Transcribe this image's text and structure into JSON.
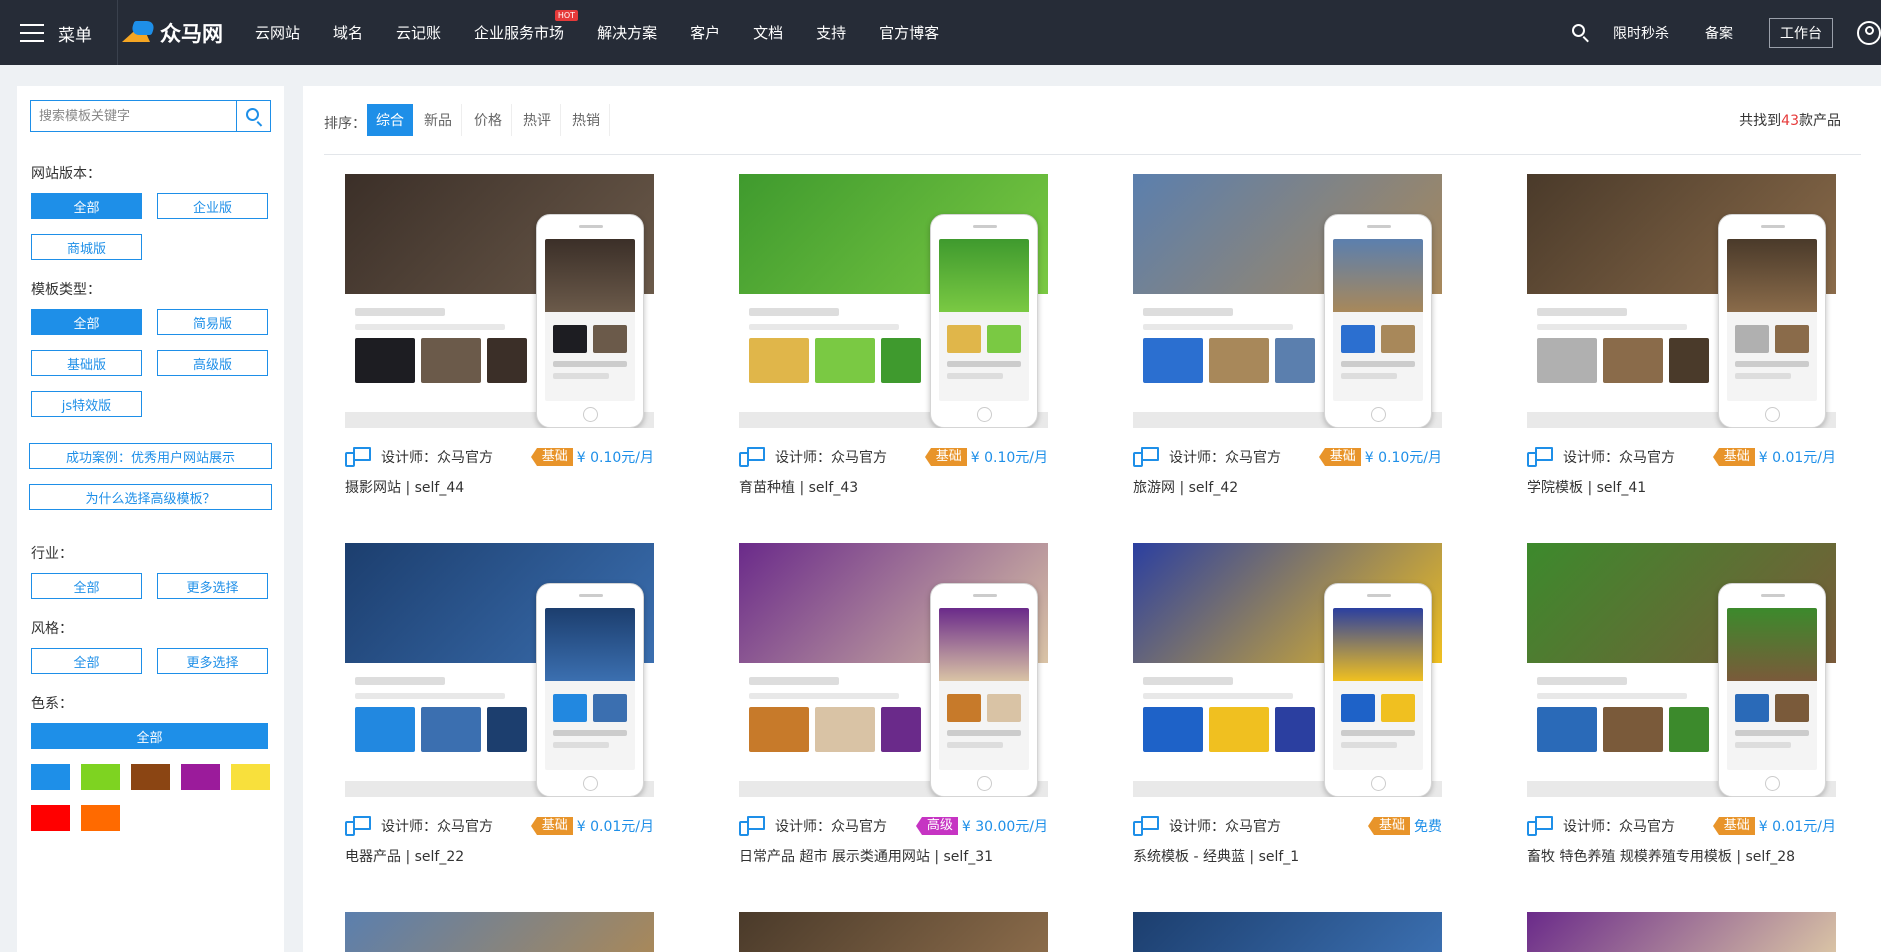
{
  "topbar": {
    "menu_label": "菜单",
    "logo_text": "众马网",
    "nav": [
      "云网站",
      "域名",
      "云记账",
      "企业服务市场",
      "解决方案",
      "客户",
      "文档",
      "支持",
      "官方博客"
    ],
    "hot_badge": "HOT",
    "right": {
      "flash_sale": "限时秒杀",
      "record": "备案",
      "workspace": "工作台"
    }
  },
  "sidebar": {
    "search_placeholder": "搜索模板关键字",
    "version_label": "网站版本：",
    "version_options": [
      "全部",
      "企业版",
      "商城版"
    ],
    "type_label": "模板类型：",
    "type_options": [
      "全部",
      "简易版",
      "基础版",
      "高级版",
      "js特效版"
    ],
    "case_link": "成功案例：优秀用户网站展示",
    "why_link": "为什么选择高级模板？",
    "industry_label": "行业：",
    "industry_all": "全部",
    "industry_more": "更多选择",
    "style_label": "风格：",
    "style_all": "全部",
    "style_more": "更多选择",
    "color_label": "色系：",
    "color_all": "全部",
    "colors": [
      "#1e8fe8",
      "#7ed321",
      "#8b4513",
      "#9b1b9b",
      "#f8e03c",
      "#ff0000",
      "#ff6a00"
    ]
  },
  "main": {
    "sort_label": "排序：",
    "sort_options": [
      "综合",
      "新品",
      "价格",
      "热评",
      "热销"
    ],
    "result_prefix": "共找到",
    "result_count": "43",
    "result_suffix": "款产品",
    "designer_label": "设计师：众马官方",
    "products": [
      {
        "name": "摄影网站 | self_44",
        "tag": "基础",
        "price": "¥ 0.10元/月"
      },
      {
        "name": "育苗种植 | self_43",
        "tag": "基础",
        "price": "¥ 0.10元/月"
      },
      {
        "name": "旅游网 | self_42",
        "tag": "基础",
        "price": "¥ 0.10元/月"
      },
      {
        "name": "学院模板 | self_41",
        "tag": "基础",
        "price": "¥ 0.01元/月"
      },
      {
        "name": "电器产品 | self_22",
        "tag": "基础",
        "price": "¥ 0.01元/月"
      },
      {
        "name": "日常产品 超市 展示类通用网站 | self_31",
        "tag": "高级",
        "price": "¥ 30.00元/月"
      },
      {
        "name": "系统模板 - 经典蓝 | self_1",
        "tag": "基础",
        "price": "免费"
      },
      {
        "name": "畜牧 特色养殖 规模养殖专用模板 | self_28",
        "tag": "基础",
        "price": "¥ 0.01元/月"
      }
    ]
  }
}
